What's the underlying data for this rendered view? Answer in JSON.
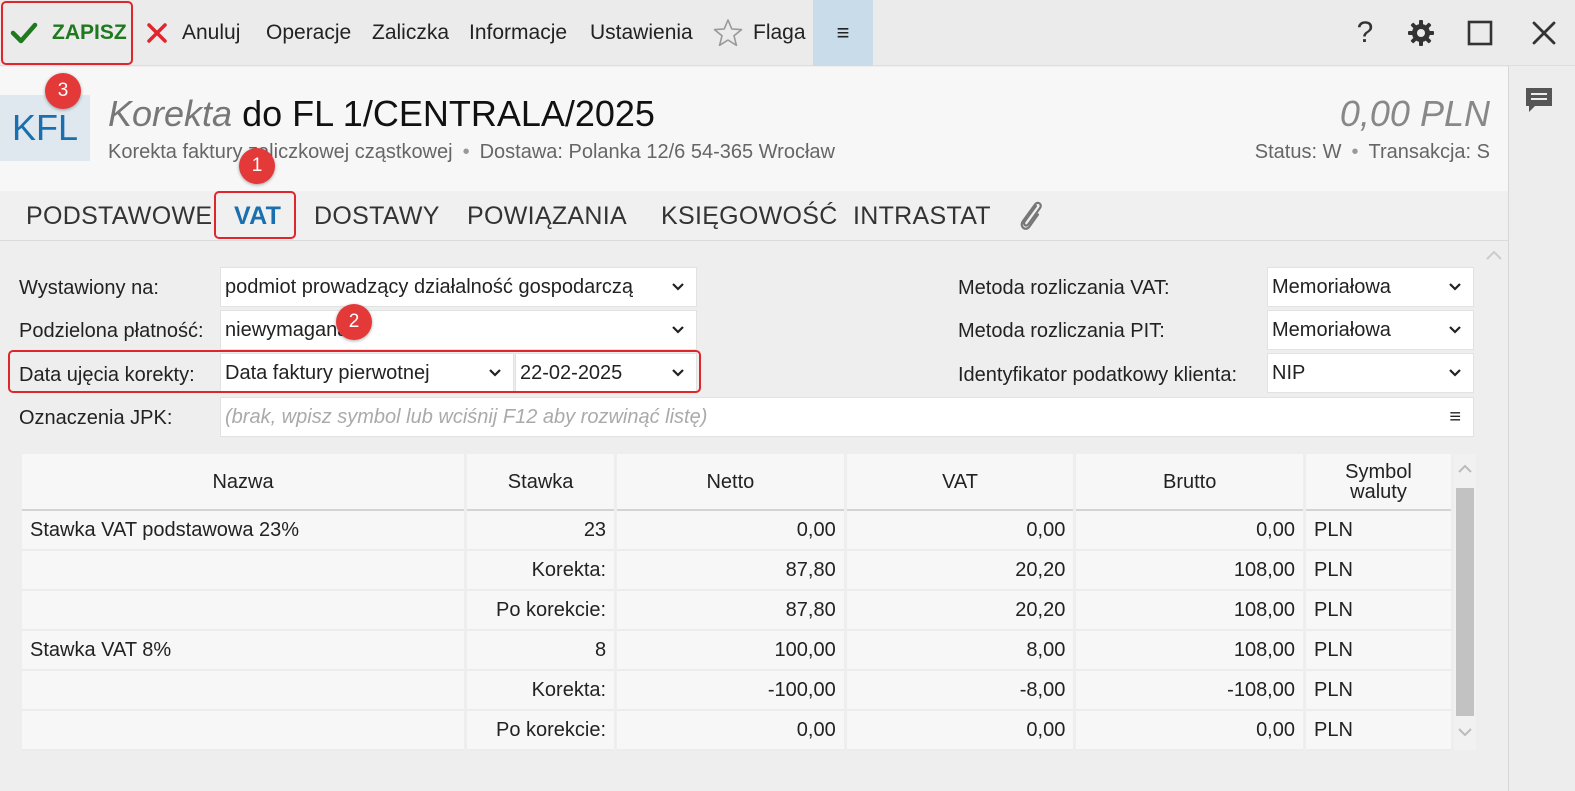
{
  "toolbar": {
    "save_label": "ZAPISZ",
    "cancel_label": "Anuluj",
    "operations_label": "Operacje",
    "advance_label": "Zaliczka",
    "info_label": "Informacje",
    "settings_label": "Ustawienia",
    "flag_label": "Flaga",
    "menu_glyph": "≡",
    "help_glyph": "?"
  },
  "header": {
    "badge": "KFL",
    "doc_kind": "Korekta",
    "doc_title": "do FL 1/CENTRALA/2025",
    "subtitle": "Korekta faktury zaliczkowej cząstkowej",
    "delivery": "Dostawa: Polanka  12/6  54-365 Wrocław",
    "amount": "0,00 PLN",
    "status": "Status:  W",
    "transaction": "Transakcja:  S"
  },
  "tabs": [
    {
      "label": "PODSTAWOWE"
    },
    {
      "label": "VAT"
    },
    {
      "label": "DOSTAWY"
    },
    {
      "label": "POWIĄZANIA"
    },
    {
      "label": "KSIĘGOWOŚĆ"
    },
    {
      "label": "INTRASTAT"
    }
  ],
  "form": {
    "issued_for_label": "Wystawiony na:",
    "issued_for_value": "podmiot prowadzący działalność gospodarczą",
    "split_payment_label": "Podzielona płatność:",
    "split_payment_value": "niewymagana",
    "correction_date_label": "Data ujęcia korekty:",
    "correction_date_mode": "Data faktury pierwotnej",
    "correction_date_value": "22-02-2025",
    "jpk_label": "Oznaczenia JPK:",
    "jpk_placeholder": "(brak, wpisz symbol lub wciśnij F12 aby rozwinąć listę)",
    "jpk_menu_glyph": "≡",
    "vat_method_label": "Metoda rozliczania VAT:",
    "vat_method_value": "Memoriałowa",
    "pit_method_label": "Metoda rozliczania PIT:",
    "pit_method_value": "Memoriałowa",
    "tax_id_label": "Identyfikator podatkowy klienta:",
    "tax_id_value": "NIP"
  },
  "table": {
    "headers": [
      "Nazwa",
      "Stawka",
      "Netto",
      "VAT",
      "Brutto",
      "Symbol waluty"
    ],
    "rows": [
      [
        "Stawka VAT podstawowa 23%",
        "23",
        "0,00",
        "0,00",
        "0,00",
        "PLN"
      ],
      [
        "",
        "Korekta:",
        "87,80",
        "20,20",
        "108,00",
        "PLN"
      ],
      [
        "",
        "Po korekcie:",
        "87,80",
        "20,20",
        "108,00",
        "PLN"
      ],
      [
        "Stawka VAT 8%",
        "8",
        "100,00",
        "8,00",
        "108,00",
        "PLN"
      ],
      [
        "",
        "Korekta:",
        "-100,00",
        "-8,00",
        "-108,00",
        "PLN"
      ],
      [
        "",
        "Po korekcie:",
        "0,00",
        "0,00",
        "0,00",
        "PLN"
      ]
    ]
  },
  "callouts": [
    "1",
    "2",
    "3"
  ],
  "colors": {
    "accent": "#1a6faf",
    "save_green": "#1f7a1f",
    "callout_red": "#e33939",
    "cancel_red": "#e0262d",
    "menu_bg": "#c9dcea"
  }
}
